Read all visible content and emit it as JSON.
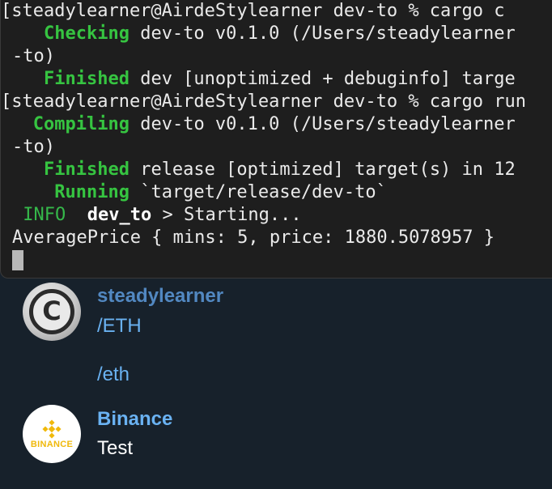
{
  "terminal": {
    "lines": [
      {
        "pre": "[steadylearner@AirdeStylearner dev-to % cargo c",
        "kw": "",
        "post": ""
      },
      {
        "pre": "    ",
        "kw": "Checking",
        "post": " dev-to v0.1.0 (/Users/steadylearner"
      },
      {
        "pre": "-to)",
        "kw": "",
        "post": ""
      },
      {
        "pre": "    ",
        "kw": "Finished",
        "post": " dev [unoptimized + debuginfo] targe"
      },
      {
        "pre": "[steadylearner@AirdeStylearner dev-to % cargo run",
        "kw": "",
        "post": ""
      },
      {
        "pre": "   ",
        "kw": "Compiling",
        "post": " dev-to v0.1.0 (/Users/steadylearner"
      },
      {
        "pre": "-to)",
        "kw": "",
        "post": ""
      },
      {
        "pre": "    ",
        "kw": "Finished",
        "post": " release [optimized] target(s) in 12"
      },
      {
        "pre": "     ",
        "kw": "Running",
        "post": " `target/release/dev-to`"
      },
      {
        "pre": " ",
        "kw": "INFO",
        "post": "  "
      },
      {
        "pre": "AveragePrice { mins: 5, price: 1880.5078957 }",
        "kw": "",
        "post": ""
      }
    ],
    "info_module": "dev_to",
    "info_message": " > Starting..."
  },
  "chat": {
    "message1": {
      "sender": "steadylearner",
      "sender_color": "#5288c1",
      "link1": "/ETH",
      "link2": "/eth"
    },
    "message2": {
      "sender": "Binance",
      "sender_color": "#6ab2f2",
      "text": "Test",
      "avatar_label": "BINANCE"
    }
  },
  "colors": {
    "terminal_bg": "#1e1e1e",
    "chat_bg": "#17212b",
    "cargo_keyword": "#36c441",
    "link": "#6ab2f2"
  }
}
